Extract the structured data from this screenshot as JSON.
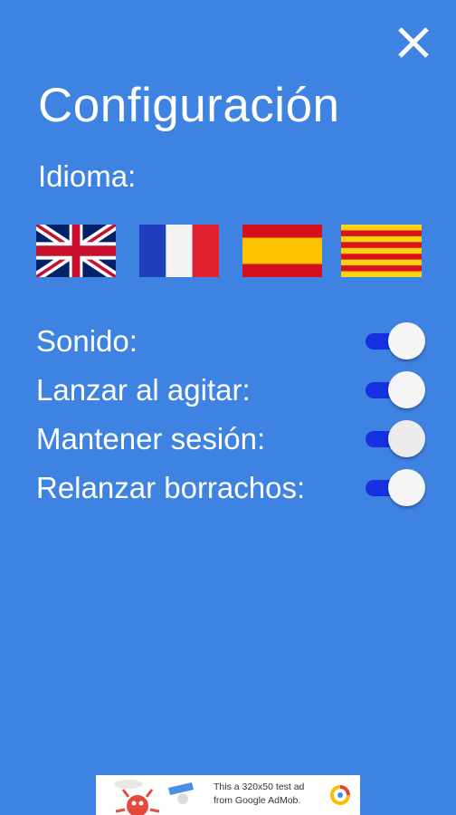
{
  "header": {
    "title": "Configuración",
    "close_label": "X",
    "close_icon": "close-icon"
  },
  "language": {
    "label": "Idioma:",
    "flags": [
      {
        "name": "English",
        "icon": "uk-flag-icon"
      },
      {
        "name": "Français",
        "icon": "france-flag-icon"
      },
      {
        "name": "Español",
        "icon": "spain-flag-icon"
      },
      {
        "name": "Català",
        "icon": "catalonia-flag-icon"
      }
    ]
  },
  "settings": [
    {
      "label": "Sonido:",
      "enabled": true
    },
    {
      "label": "Lanzar al agitar:",
      "enabled": true
    },
    {
      "label": "Mantener sesión:",
      "enabled": true
    },
    {
      "label": "Relanzar borrachos:",
      "enabled": true
    }
  ],
  "ad": {
    "text_line1": "This a 320x50 test ad",
    "text_line2": "from Google AdMob."
  },
  "colors": {
    "background": "#3f83e2",
    "toggle_track": "#1430e0",
    "toggle_knob": "#f5f5f5"
  }
}
